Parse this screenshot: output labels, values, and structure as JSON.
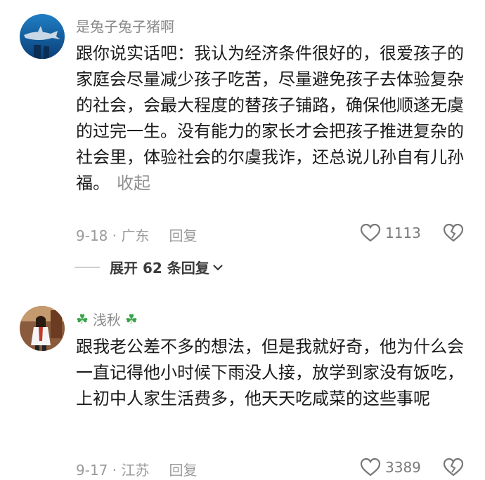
{
  "comments": [
    {
      "username": "是兔子兔子猪啊",
      "text": "跟你说实话吧：我认为经济条件很好的，很爱孩子的家庭会尽量减少孩子吃苦，尽量避免孩子去体验复杂的社会，会最大程度的替孩子铺路，确保他顺遂无虞的过完一生。没有能力的家长才会把孩子推进复杂的社会里，体验社会的尔虞我诈，还总说儿孙自有儿孙福。",
      "collapse_label": "收起",
      "date_location": "9-18 · 广东",
      "reply_label": "回复",
      "likes": "1113",
      "avatar_icon": "shark-aquarium-avatar",
      "expand_label": "展开 62 条回复"
    },
    {
      "username_prefix_icon": "four-leaf-clover",
      "username": "浅秋",
      "username_suffix_icon": "four-leaf-clover",
      "text": "跟我老公差不多的想法，但是我就好奇，他为什么会一直记得他小时候下雨没人接，放学到家没有饭吃，上初中人家生活费多，他天天吃咸菜的这些事呢",
      "date_location": "9-17 · 江苏",
      "reply_label": "回复",
      "likes": "3389",
      "avatar_icon": "woman-photo-avatar"
    }
  ],
  "colors": {
    "meta_gray": "#9a9a9a",
    "username_gray": "#8a8a8a",
    "text_dark": "#1a1a1a",
    "clover_green": "#3aa34a"
  }
}
